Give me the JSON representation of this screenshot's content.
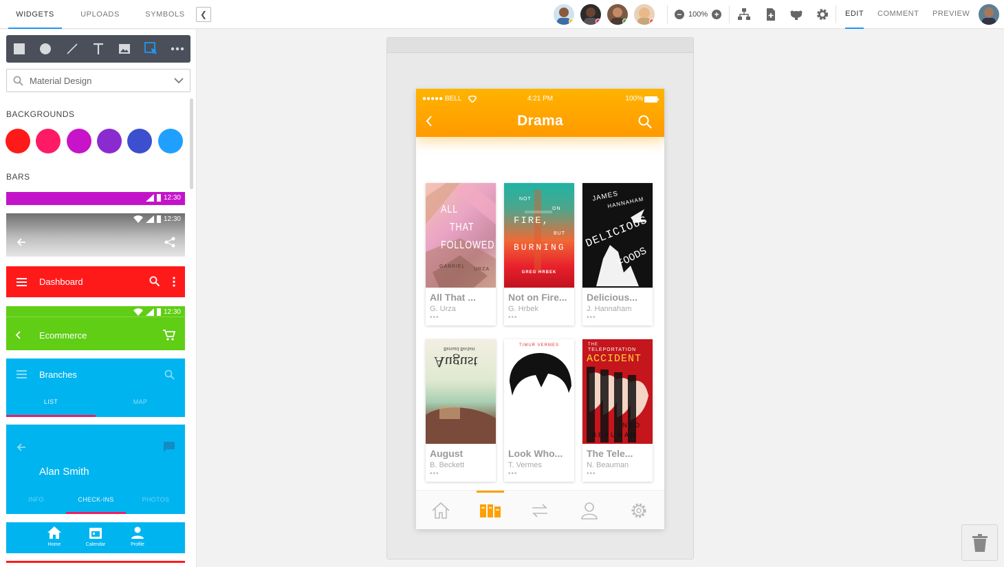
{
  "header": {
    "tabs": [
      {
        "label": "WIDGETS",
        "active": true
      },
      {
        "label": "UPLOADS",
        "active": false
      },
      {
        "label": "SYMBOLS",
        "active": false
      }
    ],
    "zoom": "100%",
    "modes": [
      {
        "label": "EDIT",
        "active": true
      },
      {
        "label": "COMMENT",
        "active": false
      },
      {
        "label": "PREVIEW",
        "active": false
      }
    ],
    "accent": "#2196f3"
  },
  "sidebar": {
    "search_value": "Material Design",
    "backgrounds_label": "BACKGROUNDS",
    "bars_label": "BARS",
    "swatches": [
      "#ff1a1a",
      "#ff1a66",
      "#c814c8",
      "#8a2bd0",
      "#3b4fcf",
      "#1fa0ff"
    ],
    "bars": {
      "time": "12:30",
      "dashboard_title": "Dashboard",
      "ecommerce_title": "Ecommerce",
      "branches_title": "Branches",
      "branches_tabs": [
        "LIST",
        "MAP"
      ],
      "profile_name": "Alan Smith",
      "profile_tabs": [
        "INFO",
        "CHECK-INS",
        "PHOTOS"
      ],
      "nav_items": [
        "Home",
        "Calendar",
        "Profile"
      ]
    }
  },
  "phone": {
    "carrier": "●●●●● BELL",
    "time": "4:21 PM",
    "battery": "100%",
    "title": "Drama",
    "brand_color": "#ffa000",
    "books": [
      {
        "title": "All That ...",
        "author": "G. Urza"
      },
      {
        "title": "Not on Fire...",
        "author": "G. Hrbek"
      },
      {
        "title": "Delicious...",
        "author": "J. Hannaham"
      },
      {
        "title": "August",
        "author": "B. Beckett"
      },
      {
        "title": "Look Who...",
        "author": "T. Vermes"
      },
      {
        "title": "The Tele...",
        "author": "N. Beauman"
      }
    ],
    "covers": {
      "c1": [
        "ALL",
        "THAT",
        "FOLLOWED",
        "GABRIEL",
        "URZA"
      ],
      "c2": [
        "NOT",
        "ON",
        "FIRE,",
        "BUT",
        "BURNING",
        "GREG HRBEK"
      ],
      "c3": [
        "JAMES",
        "HANNAHAM",
        "DELICIOUS",
        "FOODS"
      ],
      "c4": [
        "August",
        "Bernard Beckett"
      ],
      "c5": [
        "TIMUR VERMES"
      ],
      "c6": [
        "THE",
        "TELEPORTATION",
        "ACCIDENT",
        "NED",
        "BEAUMAN"
      ]
    },
    "dots": "•••"
  }
}
